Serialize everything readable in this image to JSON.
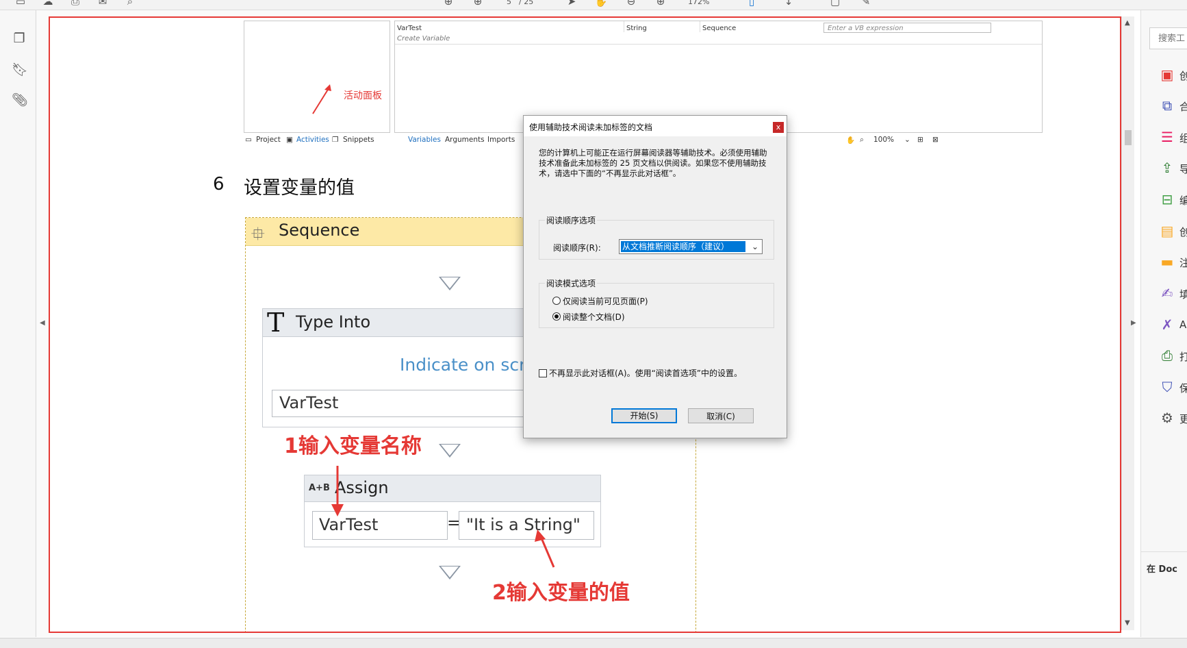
{
  "toolbar": {
    "page_current": "5",
    "page_total": "/ 25",
    "zoom": "172%"
  },
  "studio": {
    "var_name": "VarTest",
    "var_type": "String",
    "var_scope": "Sequence",
    "expr_placeholder": "Enter a VB expression",
    "create_variable": "Create Variable",
    "left_tabs": [
      "Project",
      "Activities",
      "Snippets"
    ],
    "bottom_tabs": [
      "Variables",
      "Arguments",
      "Imports"
    ],
    "zoom": "100%",
    "annotation": "活动面板"
  },
  "section": {
    "number": "6",
    "title": "设置变量的值"
  },
  "sequence": {
    "title": "Sequence",
    "type_into": {
      "title": "Type Into",
      "indicate": "Indicate on scre",
      "input_value": "VarTest"
    },
    "step1_annotation": "1输入变量名称",
    "assign": {
      "icon_text": "A+B",
      "title": "Assign",
      "left": "VarTest",
      "equals": "=",
      "right": "\"It is a String\""
    },
    "step2_annotation": "2输入变量的值"
  },
  "right_pane": {
    "search_placeholder": "搜索工",
    "tools": [
      {
        "icon": "create-pdf-icon",
        "label": "创",
        "color": "#e53935"
      },
      {
        "icon": "combine-icon",
        "label": "合",
        "color": "#3f51b5"
      },
      {
        "icon": "organize-icon",
        "label": "组",
        "color": "#e91e63"
      },
      {
        "icon": "export-icon",
        "label": "导",
        "color": "#2e7d32"
      },
      {
        "icon": "edit-icon",
        "label": "编",
        "color": "#43a047"
      },
      {
        "icon": "create-edit-icon",
        "label": "创",
        "color": "#f9a825"
      },
      {
        "icon": "comment-icon",
        "label": "注",
        "color": "#f9a825"
      },
      {
        "icon": "fill-sign-icon",
        "label": "填",
        "color": "#7e57c2"
      },
      {
        "icon": "signature-icon",
        "label": "A",
        "color": "#7e57c2"
      },
      {
        "icon": "print-production-icon",
        "label": "打",
        "color": "#2e7d32"
      },
      {
        "icon": "protect-icon",
        "label": "保",
        "color": "#3f51b5"
      },
      {
        "icon": "more-tools-icon",
        "label": "更",
        "color": "#555555"
      }
    ],
    "bottom_text": "在 Doc"
  },
  "dialog": {
    "title": "使用辅助技术阅读未加标签的文档",
    "close": "x",
    "message": "您的计算机上可能正在运行屏幕阅读器等辅助技术。必须使用辅助技术准备此未加标签的 25 页文档以供阅读。如果您不使用辅助技术，请选中下面的“不再显示此对话框”。",
    "reading_order_group": "阅读顺序选项",
    "reading_order_label": "阅读顺序(R):",
    "reading_order_value": "从文档推断阅读顺序（建议）",
    "reading_mode_group": "阅读模式选项",
    "radio_visible_pages": "仅阅读当前可见页面(P)",
    "radio_whole_doc": "阅读整个文档(D)",
    "dont_show": "不再显示此对话框(A)。使用“阅读首选项”中的设置。",
    "start_button": "开始(S)",
    "cancel_button": "取消(C)"
  }
}
